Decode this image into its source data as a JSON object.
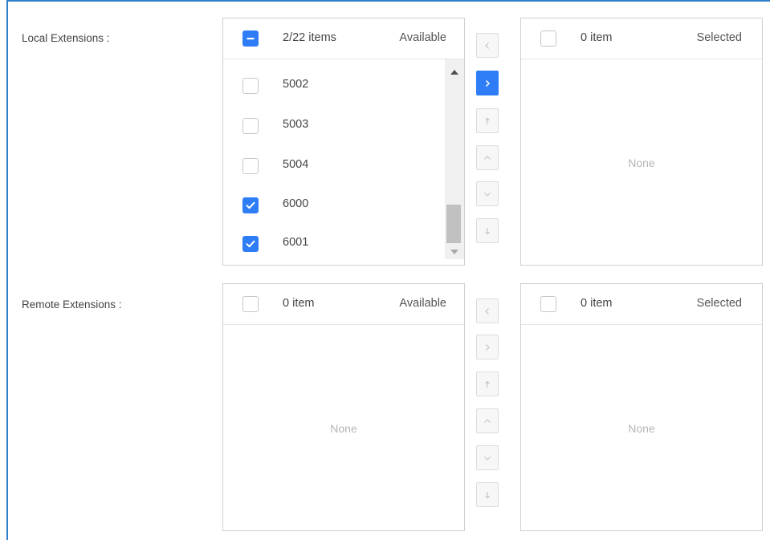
{
  "local": {
    "label": "Local Extensions :",
    "available": {
      "count": "2/22 items",
      "title": "Available",
      "header_state": "partial",
      "items": [
        {
          "label": "5002",
          "checked": false
        },
        {
          "label": "5003",
          "checked": false
        },
        {
          "label": "5004",
          "checked": false
        },
        {
          "label": "6000",
          "checked": true
        },
        {
          "label": "6001",
          "checked": true
        }
      ]
    },
    "selected": {
      "count": "0 item",
      "title": "Selected",
      "empty": "None"
    }
  },
  "remote": {
    "label": "Remote Extensions :",
    "available": {
      "count": "0 item",
      "title": "Available",
      "empty": "None"
    },
    "selected": {
      "count": "0 item",
      "title": "Selected",
      "empty": "None"
    }
  },
  "colors": {
    "accent": "#2f7df6",
    "frame": "#2f80c9",
    "border": "#cfcfcf"
  },
  "transfer_buttons": [
    "move-left",
    "move-right",
    "move-top",
    "move-up",
    "move-down",
    "move-bottom"
  ]
}
